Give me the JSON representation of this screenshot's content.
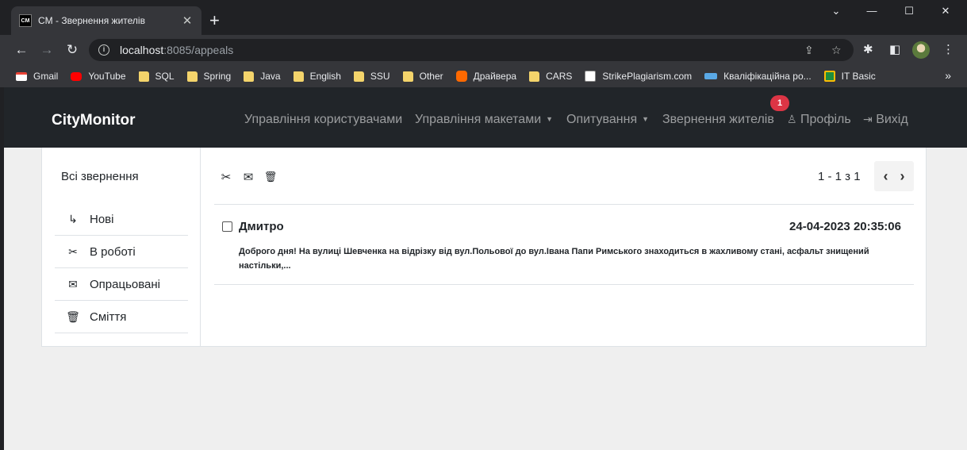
{
  "browser": {
    "tab_favicon_text": "CM",
    "tab_title": "CM - Звернення жителів",
    "url_host": "localhost",
    "url_path": ":8085/appeals",
    "bookmarks": [
      {
        "label": "Gmail",
        "icon": "gmail-icon",
        "color": "#ea4335"
      },
      {
        "label": "YouTube",
        "icon": "youtube-icon",
        "color": "#ff0000"
      },
      {
        "label": "SQL",
        "icon": "folder-icon",
        "color": "#f4d46b"
      },
      {
        "label": "Spring",
        "icon": "folder-icon",
        "color": "#f4d46b"
      },
      {
        "label": "Java",
        "icon": "folder-icon",
        "color": "#f4d46b"
      },
      {
        "label": "English",
        "icon": "folder-icon",
        "color": "#f4d46b"
      },
      {
        "label": "SSU",
        "icon": "folder-icon",
        "color": "#f4d46b"
      },
      {
        "label": "Other",
        "icon": "folder-icon",
        "color": "#f4d46b"
      },
      {
        "label": "Драйвера",
        "icon": "mi-icon",
        "color": "#ff6900"
      },
      {
        "label": "CARS",
        "icon": "folder-icon",
        "color": "#f4d46b"
      },
      {
        "label": "StrikePlagiarism.com",
        "icon": "strike-icon",
        "color": "#ffffff"
      },
      {
        "label": "Кваліфікаційна ро...",
        "icon": "qual-icon",
        "color": "#5aa9e6"
      },
      {
        "label": "IT Basic",
        "icon": "classroom-icon",
        "color": "#1e8e3e"
      }
    ]
  },
  "navbar": {
    "brand": "CityMonitor",
    "items": [
      {
        "label": "Управління користувачами"
      },
      {
        "label": "Управління макетами"
      },
      {
        "label": "Опитування"
      },
      {
        "label": "Звернення жителів"
      },
      {
        "label": "Профіль"
      },
      {
        "label": "Вихід"
      }
    ],
    "badge": "1"
  },
  "sidebar": {
    "title": "Всі звернення",
    "items": [
      {
        "label": "Нові",
        "icon": "arrow-return-icon"
      },
      {
        "label": "В роботі",
        "icon": "tools-icon"
      },
      {
        "label": "Опрацьовані",
        "icon": "envelope-check-icon"
      },
      {
        "label": "Сміття",
        "icon": "trash-icon"
      }
    ]
  },
  "pager": {
    "text": "1 - 1 з 1"
  },
  "appeals": [
    {
      "sender": "Дмитро",
      "date": "24-04-2023 20:35:06",
      "excerpt": "Доброго дня! На вулиці Шевченка на відрізку від вул.Польової до вул.Івана Папи Римського знаходиться в жахливому стані, асфальт знищений настільки,..."
    }
  ],
  "colors": {
    "navbar_bg": "#212529",
    "badge": "#dc3545",
    "page_bg": "#efefef"
  }
}
